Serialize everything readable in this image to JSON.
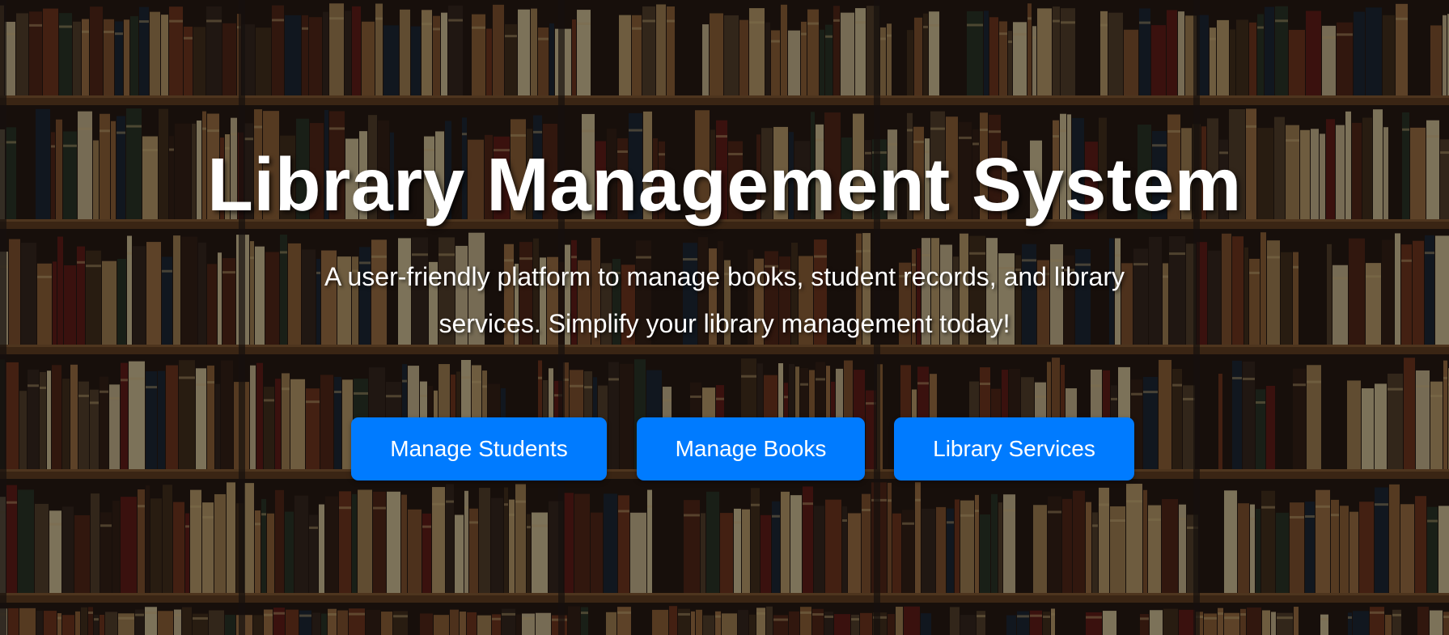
{
  "hero": {
    "title": "Library Management System",
    "subtitle": "A user-friendly platform to manage books, student records, and library services. Simplify your library management today!"
  },
  "buttons": {
    "manage_students": "Manage Students",
    "manage_books": "Manage Books",
    "library_services": "Library Services"
  },
  "colors": {
    "button_bg": "#007bff",
    "text": "#ffffff"
  },
  "background": {
    "image": "bookshelf-photo"
  }
}
